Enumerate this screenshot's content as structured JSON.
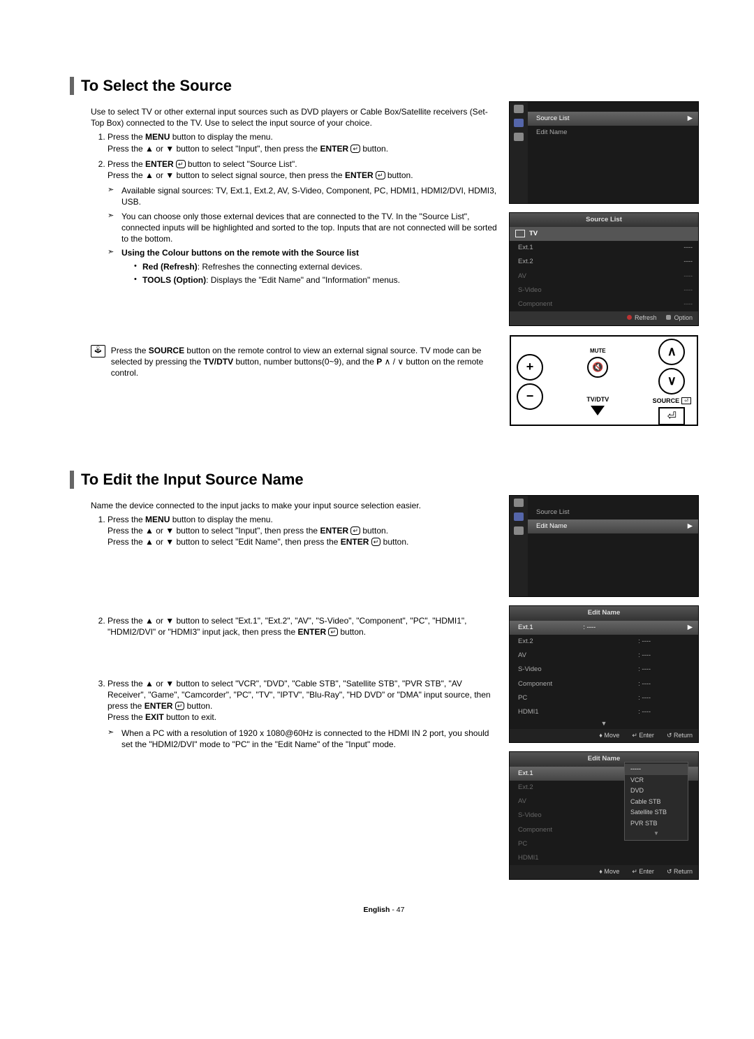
{
  "section1": {
    "heading": "To Select the Source",
    "intro": "Use to select TV or other external input sources such as DVD players or Cable Box/Satellite receivers (Set-Top Box) connected to the TV. Use to select the input source of your choice.",
    "step1a": "Press the ",
    "step1a_b": "MENU",
    "step1a2": " button to display the menu.",
    "step1b": "Press the ▲ or ▼ button to select \"Input\", then press the ",
    "step1b_b": "ENTER",
    "step1b2": " button.",
    "step2a": "Press the ",
    "step2a_b": "ENTER",
    "step2a2": " button to select \"Source List\".",
    "step2b": "Press the ▲ or ▼ button to select signal source, then press the ",
    "step2b_b": "ENTER",
    "step2b2": " button.",
    "sub1": "Available signal sources: TV, Ext.1, Ext.2, AV, S-Video, Component, PC, HDMI1, HDMI2/DVI, HDMI3, USB.",
    "sub2": "You can choose only those external devices that are connected to the TV. In the \"Source List\", connected inputs will be highlighted and sorted to the top. Inputs that are not connected will be sorted to the bottom.",
    "sub3_b": "Using the Colour buttons on the remote with the Source list",
    "dash1_b": "Red (Refresh)",
    "dash1": ": Refreshes the connecting external devices.",
    "dash2_b": "TOOLS (Option)",
    "dash2": ": Displays the \"Edit Name\" and \"Information\" menus.",
    "remote_note": "Press the SOURCE button on the remote control to view an external signal source. TV mode can be selected by pressing the TV/DTV button, number buttons(0~9), and the P ∧ / ∨ button on the remote control.",
    "remote_note_prefix": "Press the ",
    "remote_note_b1": "SOURCE",
    "remote_note_mid": " button on the remote control to view an external signal source. TV mode can be selected by pressing the ",
    "remote_note_b2": "TV/DTV",
    "remote_note_suffix": " button, number buttons(0~9), and the ",
    "remote_note_b3": "P",
    "remote_note_end": " ∧ / ∨ button on the remote control."
  },
  "osd1": {
    "item1": "Source List",
    "item2": "Edit Name"
  },
  "osd2": {
    "title": "Source List",
    "tv": "TV",
    "rows": [
      {
        "l": "Ext.1",
        "r": "----"
      },
      {
        "l": "Ext.2",
        "r": "----"
      },
      {
        "l": "AV",
        "r": "----"
      },
      {
        "l": "S-Video",
        "r": "----"
      },
      {
        "l": "Component",
        "r": "----"
      }
    ],
    "refresh": "Refresh",
    "option": "Option"
  },
  "remote": {
    "mute": "MUTE",
    "tvdtv": "TV/DTV",
    "source": "SOURCE",
    "src_btn": "⏎"
  },
  "section2": {
    "heading": "To Edit the Input Source Name",
    "intro": "Name the device connected to the input jacks to make your input source selection easier.",
    "step1a": "Press the ",
    "step1a_b": "MENU",
    "step1a2": " button to display the menu.",
    "step1b": "Press the ▲ or ▼ button to select \"Input\", then press the ",
    "step1b_b": "ENTER",
    "step1b2": " button.",
    "step1c": "Press the ▲ or ▼ button to select \"Edit Name\", then press the ",
    "step1c_b": "ENTER",
    "step1c2": " button.",
    "step2": "Press the ▲ or ▼ button to select \"Ext.1\", \"Ext.2\", \"AV\", \"S-Video\", \"Component\", \"PC\", \"HDMI1\", \"HDMI2/DVI\" or \"HDMI3\" input jack, then press the ",
    "step2_b": "ENTER",
    "step2_2": " button.",
    "step3a": "Press the ▲ or ▼ button to select \"VCR\", \"DVD\", \"Cable STB\", \"Satellite STB\", \"PVR STB\", \"AV Receiver\", \"Game\", \"Camcorder\", \"PC\", \"TV\", \"IPTV\", \"Blu-Ray\", \"HD DVD\" or \"DMA\" input source, then press the ",
    "step3_b": "ENTER",
    "step3a2": " button.",
    "step3b": "Press the ",
    "step3b_b": "EXIT",
    "step3b2": " button to exit.",
    "sub1": "When a PC with a resolution of 1920 x 1080@60Hz is connected to the HDMI IN 2 port, you should set the \"HDMI2/DVI\" mode to \"PC\" in the \"Edit Name\" of the \"Input\" mode."
  },
  "osd3": {
    "item1": "Source List",
    "item2": "Edit Name"
  },
  "osd4": {
    "title": "Edit Name",
    "rows": [
      {
        "l": "Ext.1",
        "r": ": ----"
      },
      {
        "l": "Ext.2",
        "r": ": ----"
      },
      {
        "l": "AV",
        "r": ": ----"
      },
      {
        "l": "S-Video",
        "r": ": ----"
      },
      {
        "l": "Component",
        "r": ": ----"
      },
      {
        "l": "PC",
        "r": ": ----"
      },
      {
        "l": "HDMI1",
        "r": ": ----"
      }
    ],
    "move": "Move",
    "enter": "Enter",
    "return": "Return"
  },
  "osd5": {
    "title": "Edit Name",
    "left_rows": [
      "Ext.1",
      "Ext.2",
      "AV",
      "S-Video",
      "Component",
      "PC",
      "HDMI1"
    ],
    "popup": [
      "-----",
      "VCR",
      "DVD",
      "Cable STB",
      "Satellite STB",
      "PVR STB"
    ],
    "move": "Move",
    "enter": "Enter",
    "return": "Return"
  },
  "footer": {
    "lang": "English",
    "page": "47"
  }
}
